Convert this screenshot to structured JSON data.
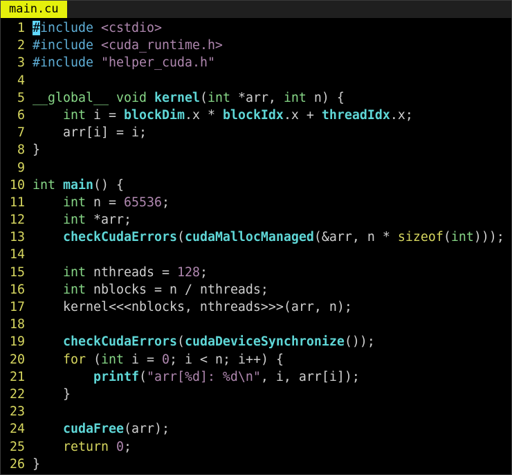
{
  "tab": {
    "filename": "main.cu",
    "active_color": "#e5f00c"
  },
  "cursor": {
    "line": 1,
    "column": 1
  },
  "lines": [
    {
      "n": "1",
      "segs": [
        [
          "cur",
          "#"
        ],
        [
          "pp",
          "include"
        ],
        [
          "code",
          " "
        ],
        [
          "str",
          "<cstdio>"
        ]
      ]
    },
    {
      "n": "2",
      "segs": [
        [
          "pp",
          "#include"
        ],
        [
          "code",
          " "
        ],
        [
          "str",
          "<cuda_runtime.h>"
        ]
      ]
    },
    {
      "n": "3",
      "segs": [
        [
          "pp",
          "#include"
        ],
        [
          "code",
          " "
        ],
        [
          "str",
          "\"helper_cuda.h\""
        ]
      ]
    },
    {
      "n": "4",
      "segs": []
    },
    {
      "n": "5",
      "segs": [
        [
          "kw",
          "__global__"
        ],
        [
          "code",
          " "
        ],
        [
          "ty",
          "void"
        ],
        [
          "code",
          " "
        ],
        [
          "fn",
          "kernel"
        ],
        [
          "code",
          "("
        ],
        [
          "ty",
          "int"
        ],
        [
          "code",
          " *arr, "
        ],
        [
          "ty",
          "int"
        ],
        [
          "code",
          " n) {"
        ]
      ]
    },
    {
      "n": "6",
      "segs": [
        [
          "code",
          "    "
        ],
        [
          "ty",
          "int"
        ],
        [
          "code",
          " i = "
        ],
        [
          "fn",
          "blockDim"
        ],
        [
          "code",
          ".x * "
        ],
        [
          "fn",
          "blockIdx"
        ],
        [
          "code",
          ".x + "
        ],
        [
          "fn",
          "threadIdx"
        ],
        [
          "code",
          ".x;"
        ]
      ]
    },
    {
      "n": "7",
      "segs": [
        [
          "code",
          "    arr[i] = i;"
        ]
      ]
    },
    {
      "n": "8",
      "segs": [
        [
          "code",
          "}"
        ]
      ]
    },
    {
      "n": "9",
      "segs": []
    },
    {
      "n": "10",
      "segs": [
        [
          "ty",
          "int"
        ],
        [
          "code",
          " "
        ],
        [
          "fn",
          "main"
        ],
        [
          "code",
          "() {"
        ]
      ]
    },
    {
      "n": "11",
      "segs": [
        [
          "code",
          "    "
        ],
        [
          "ty",
          "int"
        ],
        [
          "code",
          " n = "
        ],
        [
          "num",
          "65536"
        ],
        [
          "code",
          ";"
        ]
      ]
    },
    {
      "n": "12",
      "segs": [
        [
          "code",
          "    "
        ],
        [
          "ty",
          "int"
        ],
        [
          "code",
          " *arr;"
        ]
      ]
    },
    {
      "n": "13",
      "segs": [
        [
          "code",
          "    "
        ],
        [
          "fn",
          "checkCudaErrors"
        ],
        [
          "code",
          "("
        ],
        [
          "fn",
          "cudaMallocManaged"
        ],
        [
          "code",
          "(&arr, n * "
        ],
        [
          "yk",
          "sizeof"
        ],
        [
          "code",
          "("
        ],
        [
          "ty",
          "int"
        ],
        [
          "code",
          ")));"
        ]
      ]
    },
    {
      "n": "14",
      "segs": []
    },
    {
      "n": "15",
      "segs": [
        [
          "code",
          "    "
        ],
        [
          "ty",
          "int"
        ],
        [
          "code",
          " nthreads = "
        ],
        [
          "num",
          "128"
        ],
        [
          "code",
          ";"
        ]
      ]
    },
    {
      "n": "16",
      "segs": [
        [
          "code",
          "    "
        ],
        [
          "ty",
          "int"
        ],
        [
          "code",
          " nblocks = n / nthreads;"
        ]
      ]
    },
    {
      "n": "17",
      "segs": [
        [
          "code",
          "    kernel<<<nblocks, nthreads>>>(arr, n);"
        ]
      ]
    },
    {
      "n": "18",
      "segs": []
    },
    {
      "n": "19",
      "segs": [
        [
          "code",
          "    "
        ],
        [
          "fn",
          "checkCudaErrors"
        ],
        [
          "code",
          "("
        ],
        [
          "fn",
          "cudaDeviceSynchronize"
        ],
        [
          "code",
          "());"
        ]
      ]
    },
    {
      "n": "20",
      "segs": [
        [
          "code",
          "    "
        ],
        [
          "yk",
          "for"
        ],
        [
          "code",
          " ("
        ],
        [
          "ty",
          "int"
        ],
        [
          "code",
          " i = "
        ],
        [
          "num",
          "0"
        ],
        [
          "code",
          "; i < n; i++) {"
        ]
      ]
    },
    {
      "n": "21",
      "segs": [
        [
          "code",
          "        "
        ],
        [
          "fn",
          "printf"
        ],
        [
          "code",
          "("
        ],
        [
          "str",
          "\"arr[%d]: %d\\n\""
        ],
        [
          "code",
          ", i, arr[i]);"
        ]
      ]
    },
    {
      "n": "22",
      "segs": [
        [
          "code",
          "    }"
        ]
      ]
    },
    {
      "n": "23",
      "segs": []
    },
    {
      "n": "24",
      "segs": [
        [
          "code",
          "    "
        ],
        [
          "fn",
          "cudaFree"
        ],
        [
          "code",
          "(arr);"
        ]
      ]
    },
    {
      "n": "25",
      "segs": [
        [
          "code",
          "    "
        ],
        [
          "yk",
          "return"
        ],
        [
          "code",
          " "
        ],
        [
          "num",
          "0"
        ],
        [
          "code",
          ";"
        ]
      ]
    },
    {
      "n": "26",
      "segs": [
        [
          "code",
          "}"
        ]
      ]
    }
  ]
}
